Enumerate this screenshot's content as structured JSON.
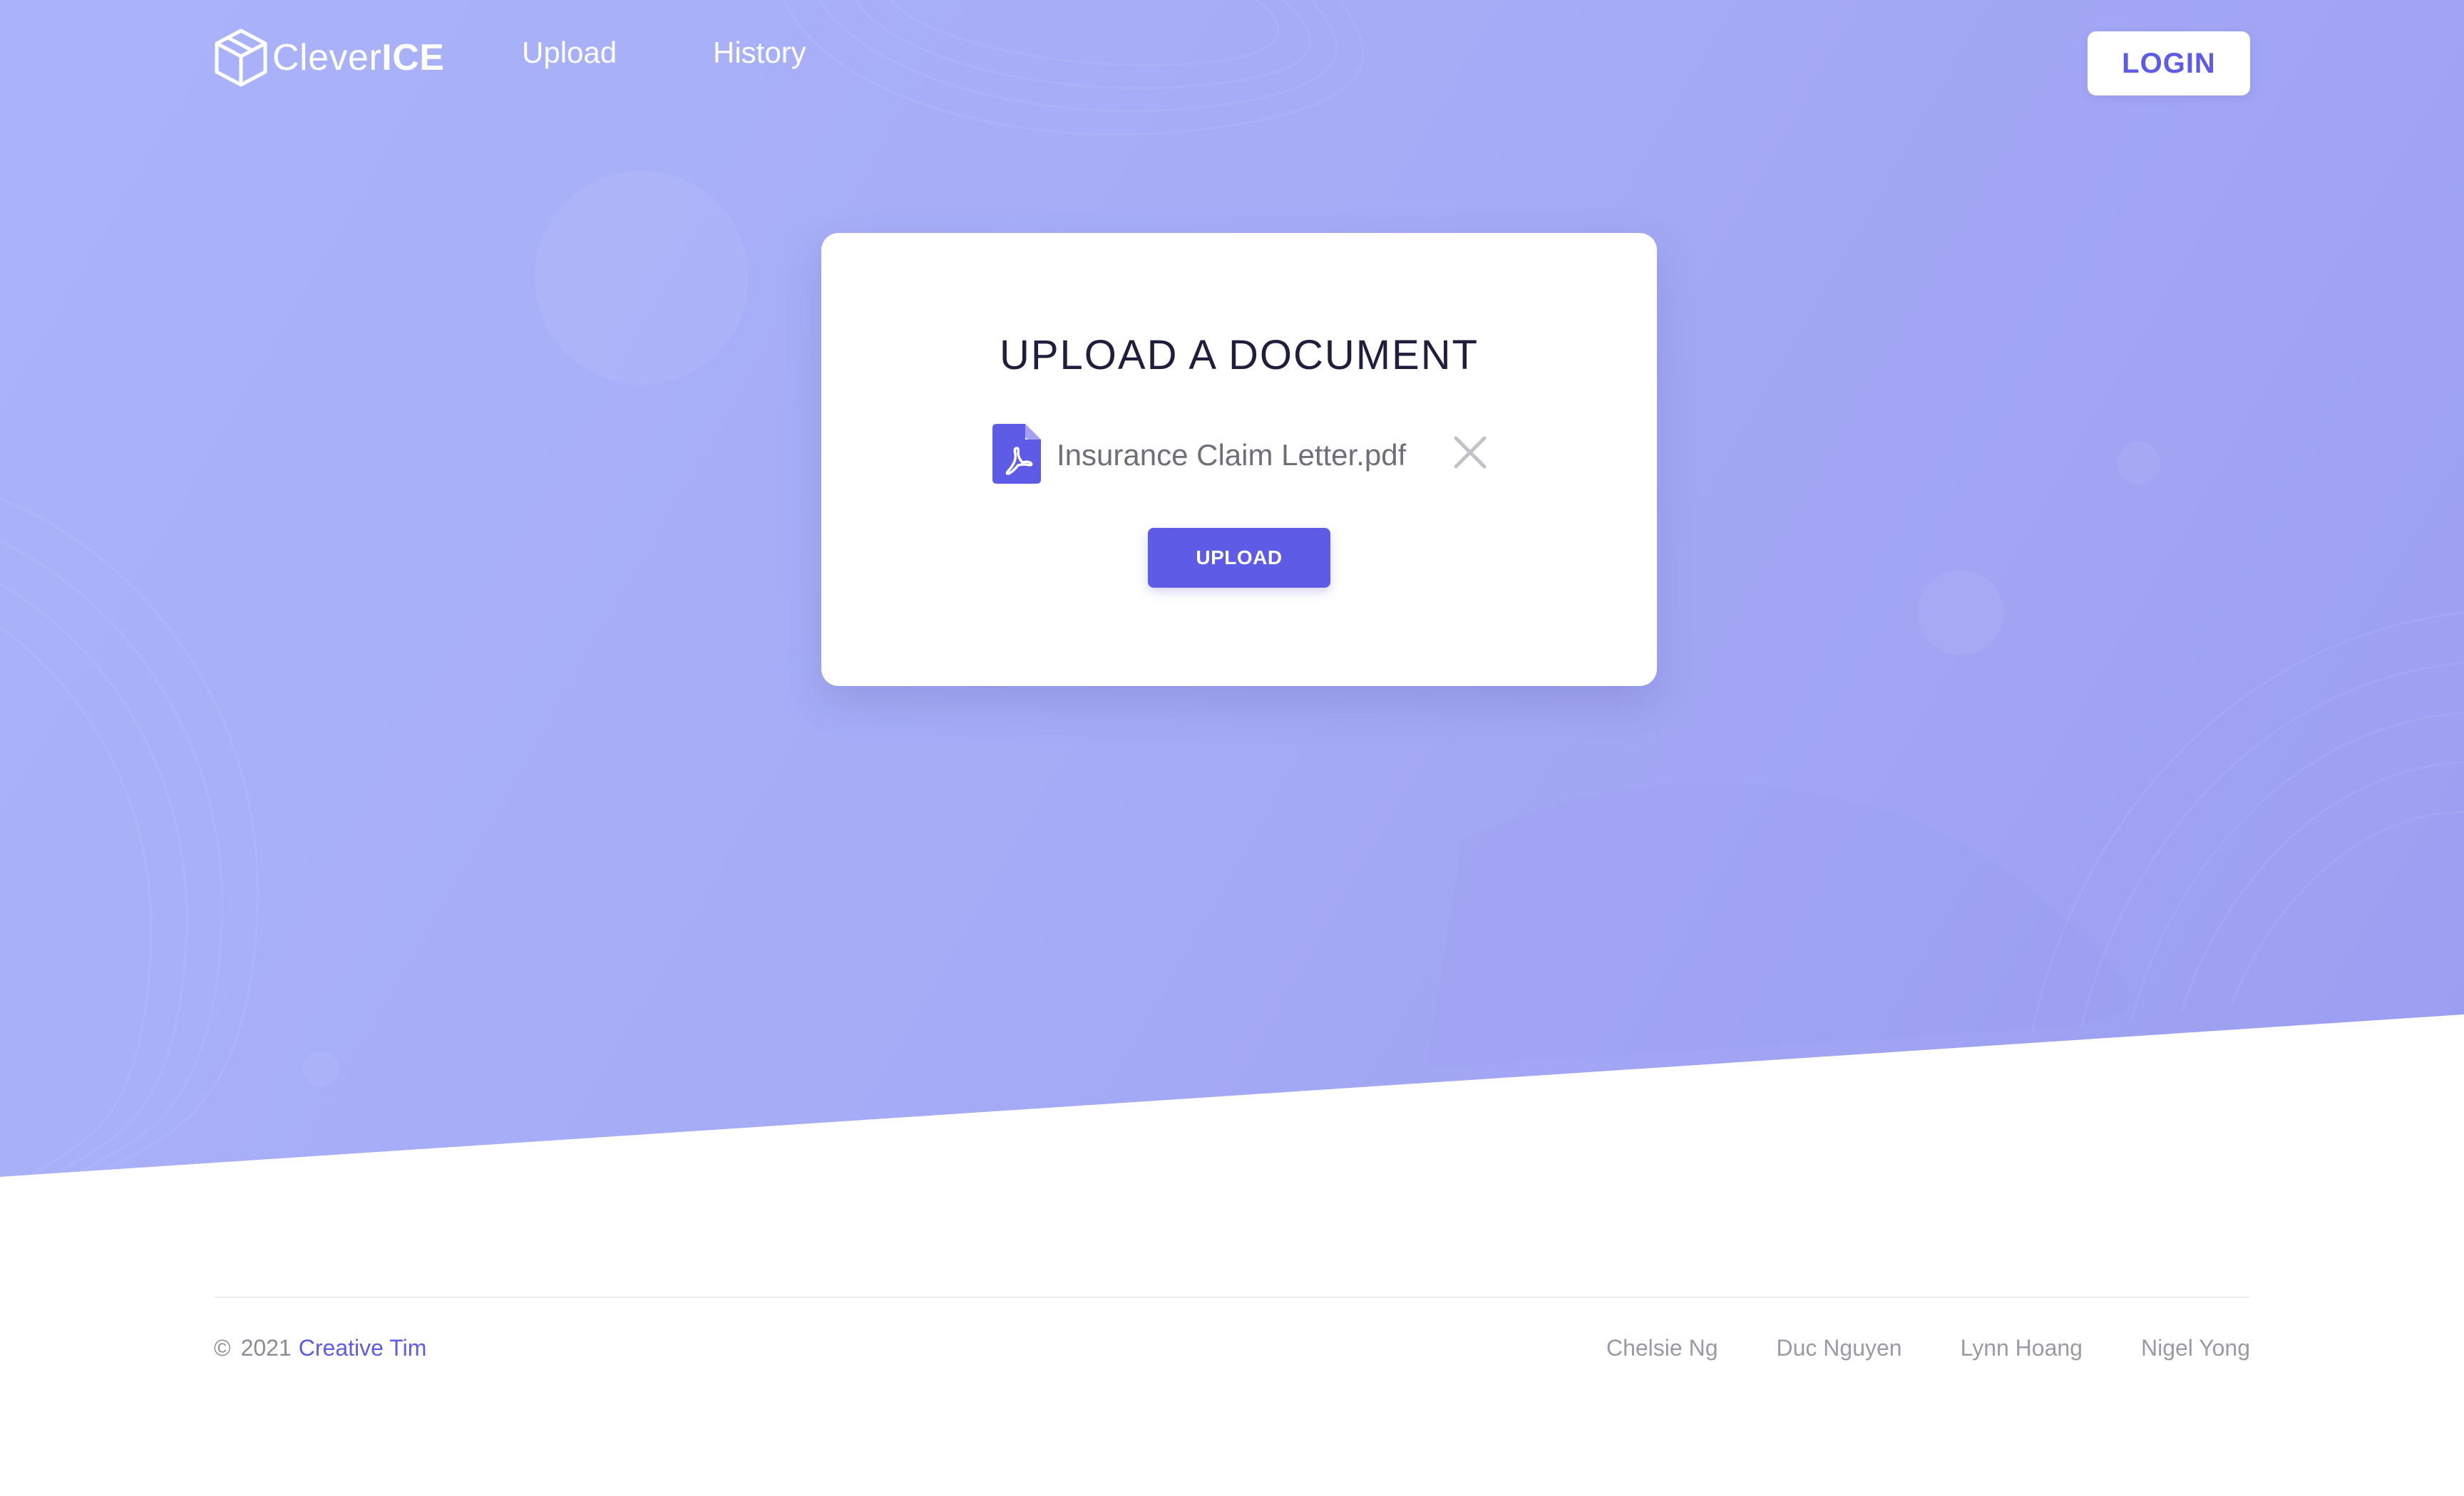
{
  "navbar": {
    "brand": {
      "name_light": "Clever",
      "name_bold": "ICE",
      "icon": "cube-icon"
    },
    "links": [
      {
        "label": "Upload"
      },
      {
        "label": "History"
      }
    ],
    "login_label": "LOGIN"
  },
  "upload_card": {
    "title": "UPLOAD A DOCUMENT",
    "file": {
      "name": "Insurance Claim Letter.pdf",
      "icon": "pdf-file-icon"
    },
    "remove_icon": "close-icon",
    "upload_label": "UPLOAD"
  },
  "footer": {
    "copyright_symbol": "©",
    "year": "2021",
    "company": "Creative Tim",
    "links": [
      {
        "label": "Chelsie Ng"
      },
      {
        "label": "Duc Nguyen"
      },
      {
        "label": "Lynn Hoang"
      },
      {
        "label": "Nigel Yong"
      }
    ]
  },
  "colors": {
    "accent": "#5e5ce6",
    "hero_gradient_start": "#aab4fa",
    "hero_gradient_end": "#9c9ef1",
    "title_text": "#1f1f3d"
  }
}
